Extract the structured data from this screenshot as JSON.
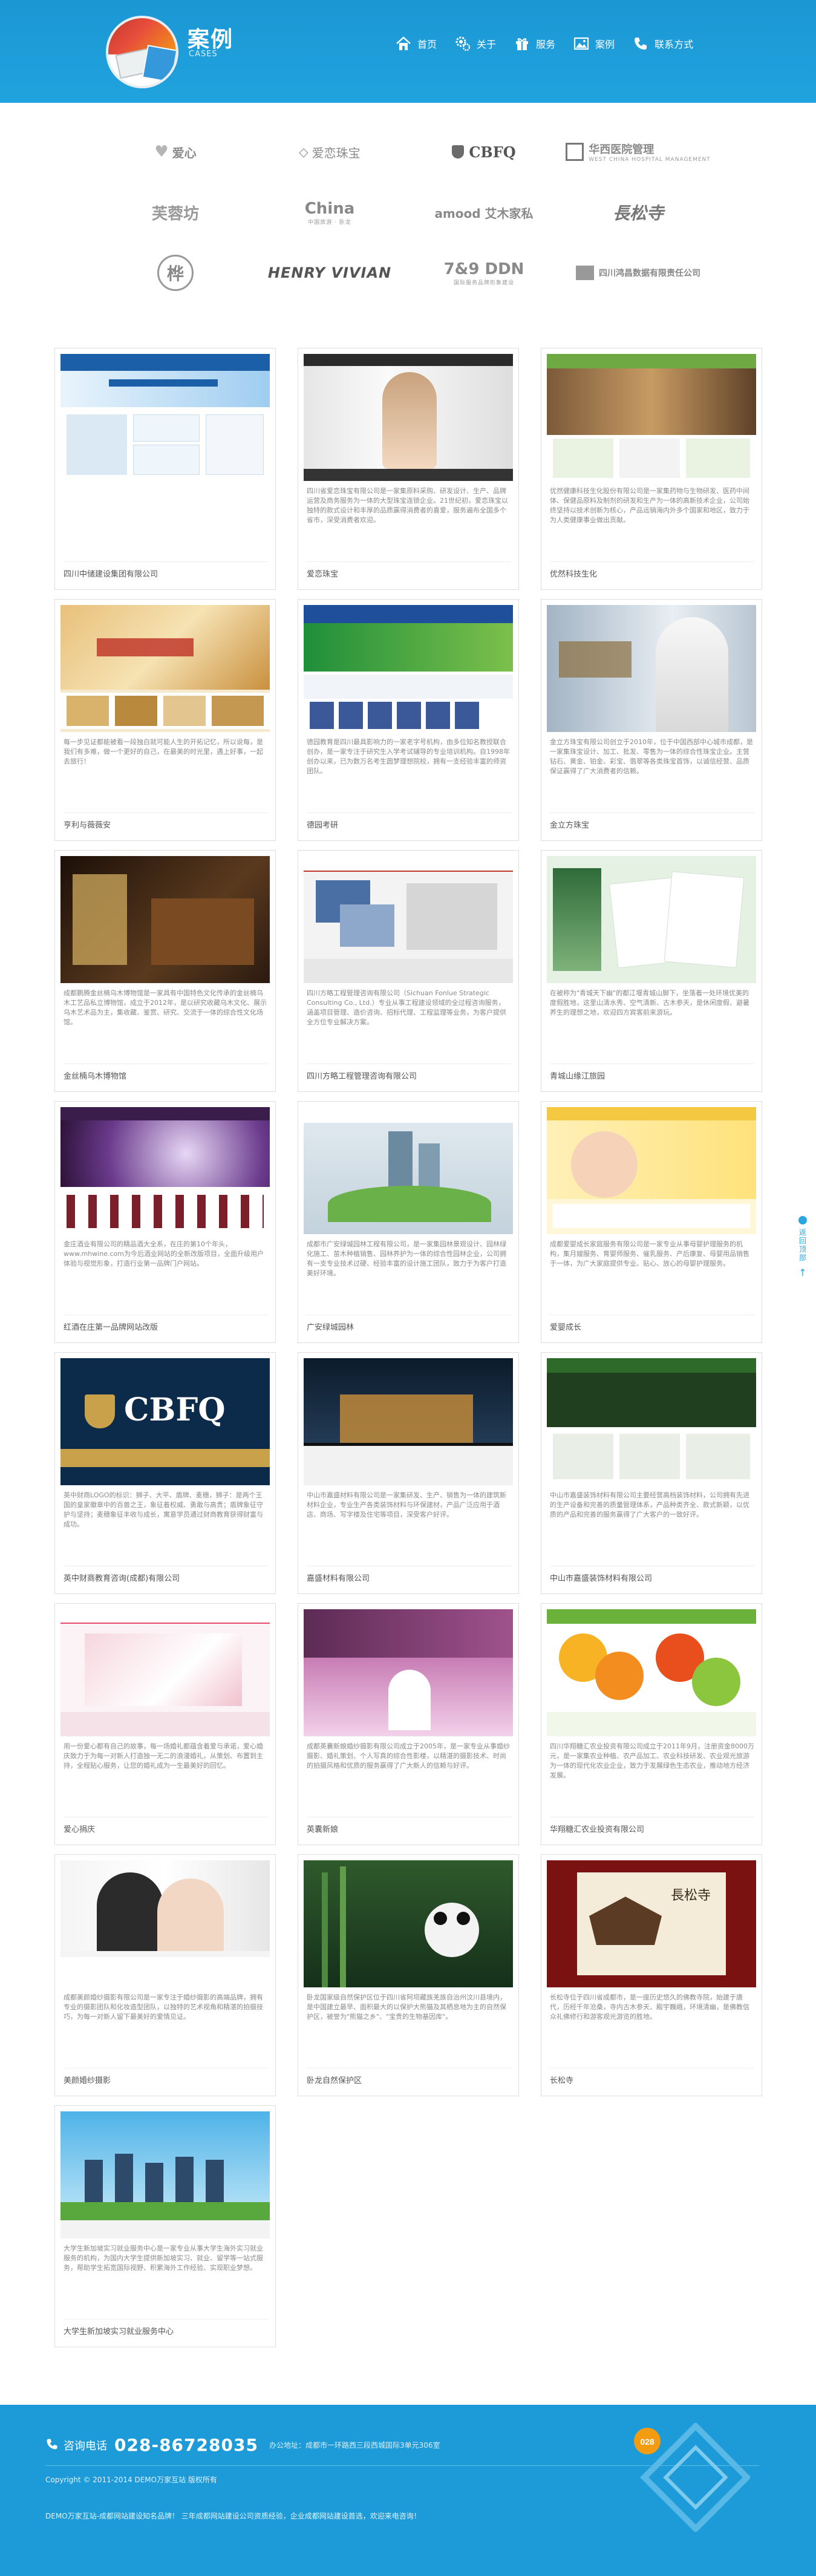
{
  "header": {
    "title": "案例",
    "subtitle": "CASES",
    "nav": [
      {
        "label": "首页",
        "icon": "home-icon"
      },
      {
        "label": "关于",
        "icon": "gear-icon"
      },
      {
        "label": "服务",
        "icon": "gift-icon"
      },
      {
        "label": "案例",
        "icon": "picture-icon"
      },
      {
        "label": "联系方式",
        "icon": "phone-icon"
      }
    ]
  },
  "brands": [
    {
      "name": "爱心",
      "sub": ""
    },
    {
      "name": "爱恋珠宝",
      "sub": ""
    },
    {
      "name": "CBFQ",
      "sub": ""
    },
    {
      "name": "华西医院管理",
      "sub": "WEST CHINA HOSPITAL MANAGEMENT"
    },
    {
      "name": "芙蓉坊",
      "sub": ""
    },
    {
      "name": "China",
      "sub": "中国旅游 · 卧龙"
    },
    {
      "name": "amood 艾木家私",
      "sub": ""
    },
    {
      "name": "長松寺",
      "sub": ""
    },
    {
      "name": "桦",
      "sub": ""
    },
    {
      "name": "HENRY VIVIAN",
      "sub": ""
    },
    {
      "name": "7&9 DDN",
      "sub": "国际服务品牌形象建设"
    },
    {
      "name": "四川鸿昌数据有限责任公司",
      "sub": ""
    }
  ],
  "cases": [
    {
      "name": "四川中储建设集团有限公司",
      "desc": ""
    },
    {
      "name": "爱恋珠宝",
      "desc": "四川省爱恋珠宝有限公司是一家集原料采购、研发设计、生产、品牌运营及商务服务为一体的大型珠宝连锁企业。21世纪初，爱恋珠宝以独特的款式设计和丰厚的品质赢得消费者的喜爱，服务遍布全国多个省市，深受消费者欢迎。"
    },
    {
      "name": "优然科技生化",
      "desc": "优然健康科技生化股份有限公司是一家集药物与生物研发、医药中间体、保健品原料及制剂的研发和生产为一体的高新技术企业，公司始终坚持以技术创新为核心，产品远销海内外多个国家和地区，致力于为人类健康事业做出贡献。"
    },
    {
      "name": "亨利与薇薇安",
      "desc": "每一步见证都能被看一段独白就可能人生的开拓记忆，所以说每，是我们有多难，做一个更好的自己，在最美的时光里，遇上好事，一起去旅行！"
    },
    {
      "name": "德园考研",
      "desc": "德园教育是四川最具影响力的一家老字号机构，由多位知名教授联合创办，是一家专注于研究生入学考试辅导的专业培训机构。自1998年创办以来，已为数万名考生圆梦理想院校，拥有一支经验丰富的师资团队。"
    },
    {
      "name": "金立方珠宝",
      "desc": "金立方珠宝有限公司创立于2010年，位于中国西部中心城市成都，是一家集珠宝设计、加工、批发、零售为一体的综合性珠宝企业。主营钻石、黄金、铂金、彩宝、翡翠等各类珠宝首饰，以诚信经营、品质保证赢得了广大消费者的信赖。"
    },
    {
      "name": "金丝楠乌木博物馆",
      "desc": "成都鹏腾金丝楠乌木博物馆是一家具有中国特色文化传承的金丝楠乌木工艺品私立博物馆，成立于2012年，是以研究收藏乌木文化、展示乌木艺术品为主，集收藏、鉴赏、研究、交流于一体的综合性文化场馆。"
    },
    {
      "name": "四川方略工程管理咨询有限公司",
      "desc": "四川方略工程管理咨询有限公司（Sichuan Fonlue Strategic Consulting Co., Ltd.）专业从事工程建设领域的全过程咨询服务，涵盖项目管理、造价咨询、招标代理、工程监理等业务，为客户提供全方位专业解决方案。"
    },
    {
      "name": "青城山缘江旅园",
      "desc": "在被称为\"青城天下幽\"的都江堰青城山脚下，坐落着一处环境优美的度假胜地，这里山清水秀、空气清新、古木参天，是休闲度假、避暑养生的理想之地，欢迎四方宾客前来游玩。"
    },
    {
      "name": "红酒在庄第一品牌网站改版",
      "desc": "金庄酒业有限公司的精品酒大全系，在庄的第10个年头，www.mhwine.com为今后酒业网站的全新改版项目，全面升级用户体验与视觉形象，打造行业第一品牌门户网站。"
    },
    {
      "name": "广安绿城园林",
      "desc": "成都市广安绿城园林工程有限公司，是一家集园林景观设计、园林绿化施工、苗木种植销售、园林养护为一体的综合性园林企业，公司拥有一支专业技术过硬、经验丰富的设计施工团队，致力于为客户打造美好环境。"
    },
    {
      "name": "爱婴成长",
      "desc": "成都爱婴成长家庭服务有限公司是一家专业从事母婴护理服务的机构，集月嫂服务、育婴师服务、催乳服务、产后康复、母婴用品销售于一体，为广大家庭提供专业、贴心、放心的母婴护理服务。"
    },
    {
      "name": "英中财商教育咨询(成都)有限公司",
      "desc": "英中财商LOGO的标识：狮子、大平、盾牌、麦穗，狮子：是两个王国的皇家徽章中的百兽之王，象征着权威、勇敢与高贵；盾牌象征守护与坚持；麦穗象征丰收与成长，寓意学员通过财商教育获得财富与成功。"
    },
    {
      "name": "嘉盛材料有限公司",
      "desc": "中山市嘉盛材料有限公司是一家集研发、生产、销售为一体的建筑新材料企业，专业生产各类装饰材料与环保建材，产品广泛应用于酒店、商场、写字楼及住宅等项目，深受客户好评。"
    },
    {
      "name": "中山市嘉盛装饰材料有限公司",
      "desc": "中山市嘉盛装饰材料有限公司主要经营高档装饰材料，公司拥有先进的生产设备和完善的质量管理体系，产品种类齐全、款式新颖，以优质的产品和完善的服务赢得了广大客户的一致好评。"
    },
    {
      "name": "爱心捐庆",
      "desc": "用一份爱心都有自己的故事，每一场婚礼都蕴含着爱与承诺，爱心婚庆致力于为每一对新人打造独一无二的浪漫婚礼，从策划、布置到主持，全程贴心服务，让您的婚礼成为一生最美好的回忆。"
    },
    {
      "name": "英囊新娘",
      "desc": "成都英囊新娘婚纱摄影有限公司成立于2005年，是一家专业从事婚纱摄影、婚礼策划、个人写真的综合性影楼，以精湛的摄影技术、时尚的拍摄风格和优质的服务赢得了广大新人的信赖与好评。"
    },
    {
      "name": "华翔糖汇农业投资有限公司",
      "desc": "四川华翔糖汇农业投资有限公司成立于2011年9月，注册资金8000万元，是一家集农业种植、农产品加工、农业科技研发、农业观光旅游为一体的现代化农业企业，致力于发展绿色生态农业，推动地方经济发展。"
    },
    {
      "name": "美颜婚纱摄影",
      "desc": "成都美颜婚纱摄影有限公司是一家专注于婚纱摄影的高端品牌，拥有专业的摄影团队和化妆造型团队，以独特的艺术视角和精湛的拍摄技巧，为每一对新人留下最美好的爱情见证。"
    },
    {
      "name": "卧龙自然保护区",
      "desc": "卧龙国家级自然保护区位于四川省阿坝藏族羌族自治州汶川县境内，是中国建立最早、面积最大的以保护大熊猫及其栖息地为主的自然保护区，被誉为\"熊猫之乡\"、\"宝贵的生物基因库\"。"
    },
    {
      "name": "长松寺",
      "desc": "长松寺位于四川省成都市，是一座历史悠久的佛教寺院，始建于唐代，历经千年沧桑，寺内古木参天、殿宇巍峨，环境清幽，是佛教信众礼佛修行和游客观光游览的胜地。"
    },
    {
      "name": "大学生新加坡实习就业服务中心",
      "desc": "大学生新加坡实习就业服务中心是一家专业从事大学生海外实习就业服务的机构，为国内大学生提供新加坡实习、就业、留学等一站式服务，帮助学生拓宽国际视野、积累海外工作经验、实现职业梦想。"
    }
  ],
  "side_tool": {
    "label": "返回顶部"
  },
  "footer": {
    "phone_label": "咨询电话",
    "phone": "028-86728035",
    "address": "办公地址：成都市一环路西三段西城国际3单元306室",
    "copyright": "Copyright © 2011-2014 DEMO万家互站 版权所有",
    "links": "DEMO万家互站-成都网站建设知名品牌！ 三年成都网站建设公司资质经验，企业成都网站建设首选，欢迎来电咨询！"
  },
  "colors": {
    "brand": "#1d9bd8",
    "card_border": "#dedede"
  }
}
